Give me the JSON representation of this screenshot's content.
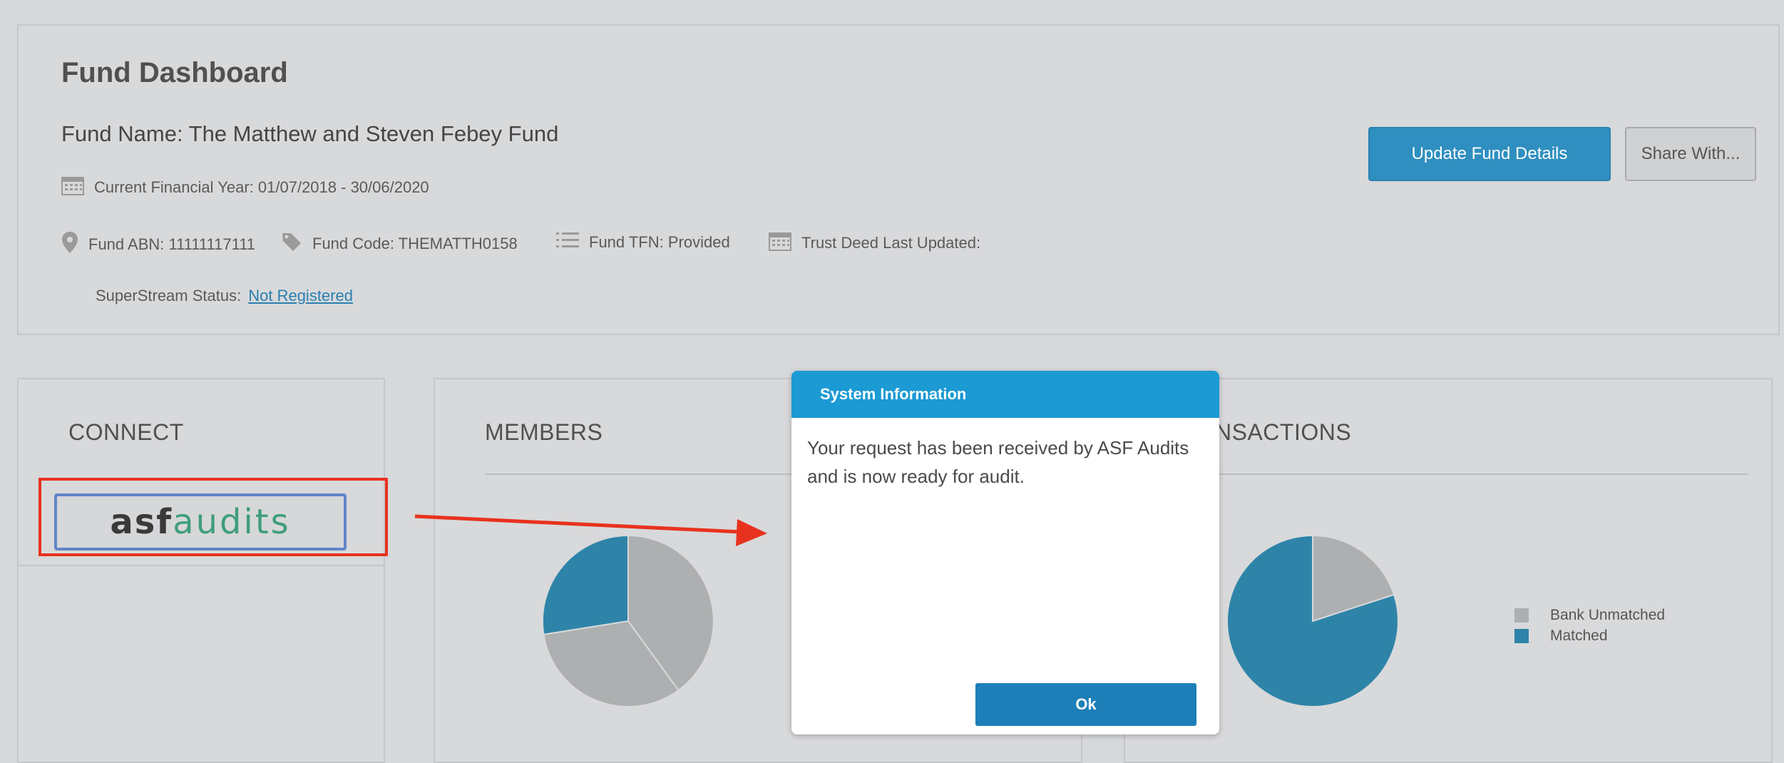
{
  "header": {
    "title": "Fund Dashboard",
    "fund_name": "Fund Name: The Matthew and Steven Febey Fund",
    "financial_year": "Current Financial Year: 01/07/2018 - 30/06/2020",
    "abn": "Fund ABN: 11111117111",
    "code": "Fund Code: THEMATTH0158",
    "tfn": "Fund TFN: Provided",
    "trust_deed": "Trust Deed Last Updated:",
    "superstream_label": "SuperStream Status:",
    "superstream_value": "Not Registered",
    "update_button": "Update Fund Details",
    "share_button": "Share With...",
    "icons": [
      "calendar-icon",
      "location-pin-icon",
      "tag-icon",
      "list-icon",
      "calendar-icon"
    ]
  },
  "connect": {
    "title": "CONNECT",
    "logo_part1": "asf",
    "logo_part2": "audits"
  },
  "members": {
    "title": "MEMBERS"
  },
  "transactions": {
    "title_visible": "NSACTIONS",
    "legend": [
      {
        "label": "Bank Unmatched",
        "color": "#adafb0"
      },
      {
        "label": "Matched",
        "color": "#2e84a8"
      }
    ]
  },
  "dialog": {
    "title": "System Information",
    "message": "Your request has been received by ASF Audits and is now ready for audit.",
    "ok_label": "Ok"
  },
  "annotation": {
    "color": "#e8321e"
  },
  "colors": {
    "background": "#d7d8da",
    "primary": "#2f8fc0",
    "dialog_header": "#1b9ad3"
  }
}
